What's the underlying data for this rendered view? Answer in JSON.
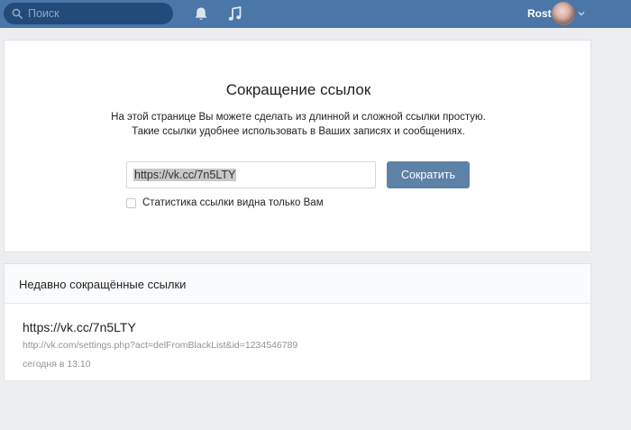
{
  "header": {
    "search_placeholder": "Поиск",
    "user_name": "Rost",
    "icons": [
      "search-icon",
      "bell-icon",
      "music-icon",
      "chevron-down-icon"
    ],
    "colors": {
      "bar": "#4a76a8",
      "search_bg": "#224b7a"
    }
  },
  "shortener": {
    "title": "Сокращение ссылок",
    "description_line1": "На этой странице Вы можете сделать из длинной и сложной ссылки простую.",
    "description_line2": "Такие ссылки удобнее использовать в Ваших записях и сообщениях.",
    "input_value": "https://vk.cc/7n5LTY",
    "button_label": "Сократить",
    "checkbox_label": "Статистика ссылки видна только Вам",
    "checkbox_checked": false,
    "button_color": "#5e81a8"
  },
  "recent": {
    "title": "Недавно сокращённые ссылки",
    "items": [
      {
        "short_link": "https://vk.cc/7n5LTY",
        "long_link": "http://vk.com/settings.php?act=delFromBlackList&id=1234546789",
        "date": "сегодня в 13:10"
      }
    ]
  }
}
